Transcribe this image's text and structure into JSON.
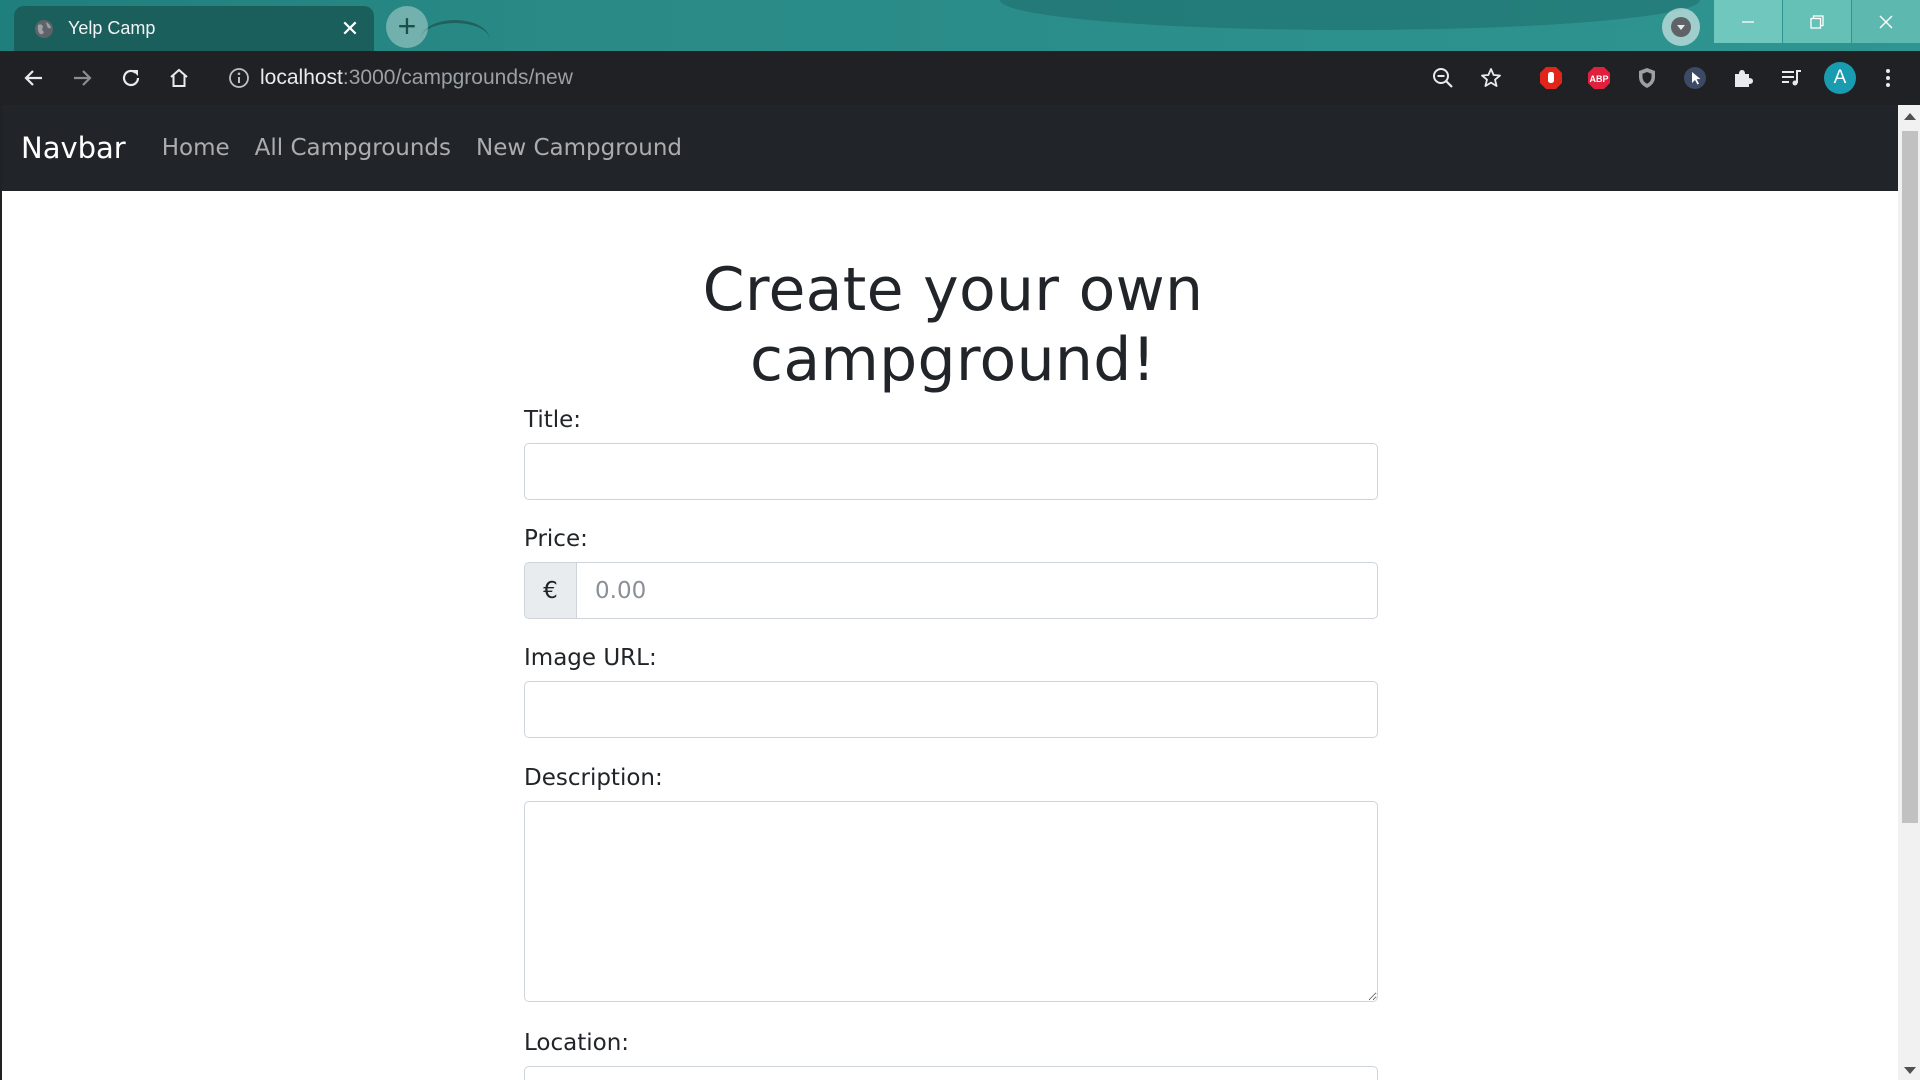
{
  "browser": {
    "tab_title": "Yelp Camp",
    "tab_close": "✕",
    "new_tab": "+",
    "url_host": "localhost",
    "url_path": ":3000/campgrounds/new",
    "profile_initial": "A",
    "extension_abp": "ABP",
    "colors": {
      "tabstrip": "#2a8a86",
      "toolbar": "#202124",
      "profile": "#1a9cb0"
    }
  },
  "navbar": {
    "brand": "Navbar",
    "links": [
      "Home",
      "All Campgrounds",
      "New Campground"
    ],
    "background": "#212529"
  },
  "form": {
    "title": "Create your own campground!",
    "title_label": "Title:",
    "title_value": "",
    "price_label": "Price:",
    "price_prefix": "€",
    "price_placeholder": "0.00",
    "image_label": "Image URL:",
    "image_value": "",
    "description_label": "Description:",
    "description_value": "",
    "location_label": "Location:"
  }
}
